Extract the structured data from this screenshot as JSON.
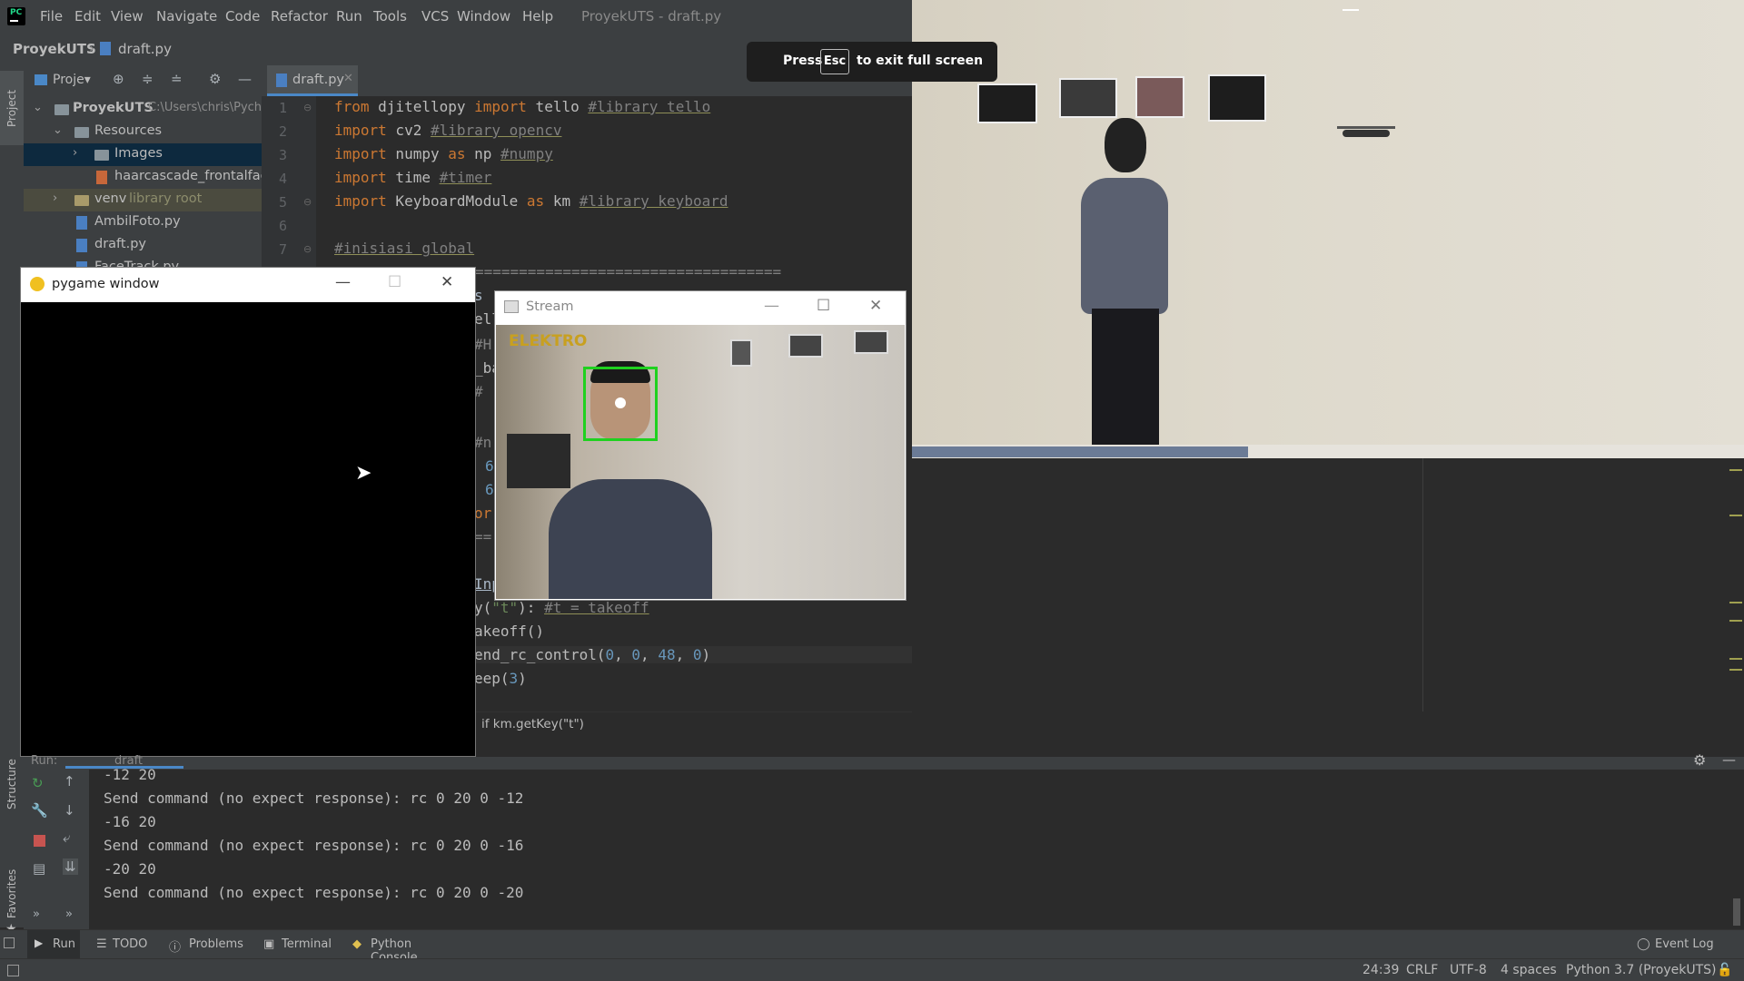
{
  "menu": {
    "items": [
      "File",
      "Edit",
      "View",
      "Navigate",
      "Code",
      "Refactor",
      "Run",
      "Tools",
      "VCS",
      "Window",
      "Help"
    ],
    "window_title": "ProyekUTS - draft.py"
  },
  "breadcrumb": {
    "project": "ProyekUTS",
    "file": "draft.py"
  },
  "left_strip": {
    "project_label": "Project",
    "structure_label": "Structure",
    "favorites_label": "Favorites"
  },
  "project_panel": {
    "dropdown_label": "Proje▾",
    "tree": [
      {
        "label": "ProyekUTS",
        "note": "C:\\Users\\chris\\Pych"
      },
      {
        "label": "Resources"
      },
      {
        "label": "Images"
      },
      {
        "label": "haarcascade_frontalface_"
      },
      {
        "label": "venv",
        "note": "library root"
      },
      {
        "label": "AmbilFoto.py"
      },
      {
        "label": "draft.py"
      },
      {
        "label": "FaceTrack.py"
      }
    ]
  },
  "editor": {
    "tab_label": "draft.py",
    "line_numbers": [
      "1",
      "2",
      "3",
      "4",
      "5",
      "6",
      "7"
    ],
    "lines": [
      {
        "kw1": "from",
        "a": " djitellopy ",
        "kw2": "import",
        "b": " tello ",
        "comment": "#library tello"
      },
      {
        "kw1": "import",
        "a": " cv2 ",
        "kw2": "",
        "b": "",
        "comment": "#library opencv"
      },
      {
        "kw1": "import",
        "a": " numpy ",
        "kw2": "as",
        "b": " np ",
        "comment": "#numpy"
      },
      {
        "kw1": "import",
        "a": " time ",
        "kw2": "",
        "b": "",
        "comment": "#timer"
      },
      {
        "kw1": "import",
        "a": " KeyboardModule ",
        "kw2": "as",
        "b": " km ",
        "comment": "#library keyboard"
      },
      {
        "kw1": "",
        "a": "",
        "kw2": "",
        "b": "",
        "comment": ""
      },
      {
        "kw1": "",
        "a": "",
        "kw2": "",
        "b": "",
        "comment": "#inisiasi global"
      }
    ],
    "separator": "===================================",
    "partial_left": [
      "s",
      "ell",
      "#H",
      "_ba",
      "#",
      "#n",
      "6",
      "6",
      "or",
      "==",
      "Inp"
    ],
    "partial_right": {
      "l1_a": "y(",
      "l1_str": "\"t\"",
      "l1_b": "): ",
      "l1_cm": "#t = takeoff",
      "l2": "akeoff()",
      "l3_a": "end_rc_control(",
      "l3_nums": [
        "0",
        "0",
        "48",
        "0"
      ],
      "l3_b": ")",
      "l4_a": "eep(",
      "l4_num": "3",
      "l4_b": ")"
    },
    "crumb": "if km.getKey(\"t\")"
  },
  "toast": {
    "press": "Press",
    "key": "Esc",
    "rest": "to exit full screen"
  },
  "pygame_window": {
    "title": "pygame window"
  },
  "stream_window": {
    "title": "Stream",
    "banner": "ELEKTRO"
  },
  "run_panel": {
    "tab_label": "Run:",
    "config": "draft",
    "output": [
      "-12 20",
      "Send command (no expect response): rc 0 20 0 -12",
      "-16 20",
      "Send command (no expect response): rc 0 20 0 -16",
      "-20 20",
      "Send command (no expect response): rc 0 20 0 -20"
    ]
  },
  "bottom_tabs": {
    "run": "Run",
    "todo": "TODO",
    "problems": "Problems",
    "terminal": "Terminal",
    "python_console": "Python Console",
    "event_log": "Event Log"
  },
  "status": {
    "position": "24:39",
    "line_sep": "CRLF",
    "encoding": "UTF-8",
    "indent": "4 spaces",
    "interpreter": "Python 3.7 (ProyekUTS)"
  },
  "colors": {
    "accent": "#4a88c7",
    "face_box": "#1fd11f",
    "keyword": "#cc7832",
    "comment": "#808080",
    "number": "#6897bb"
  }
}
